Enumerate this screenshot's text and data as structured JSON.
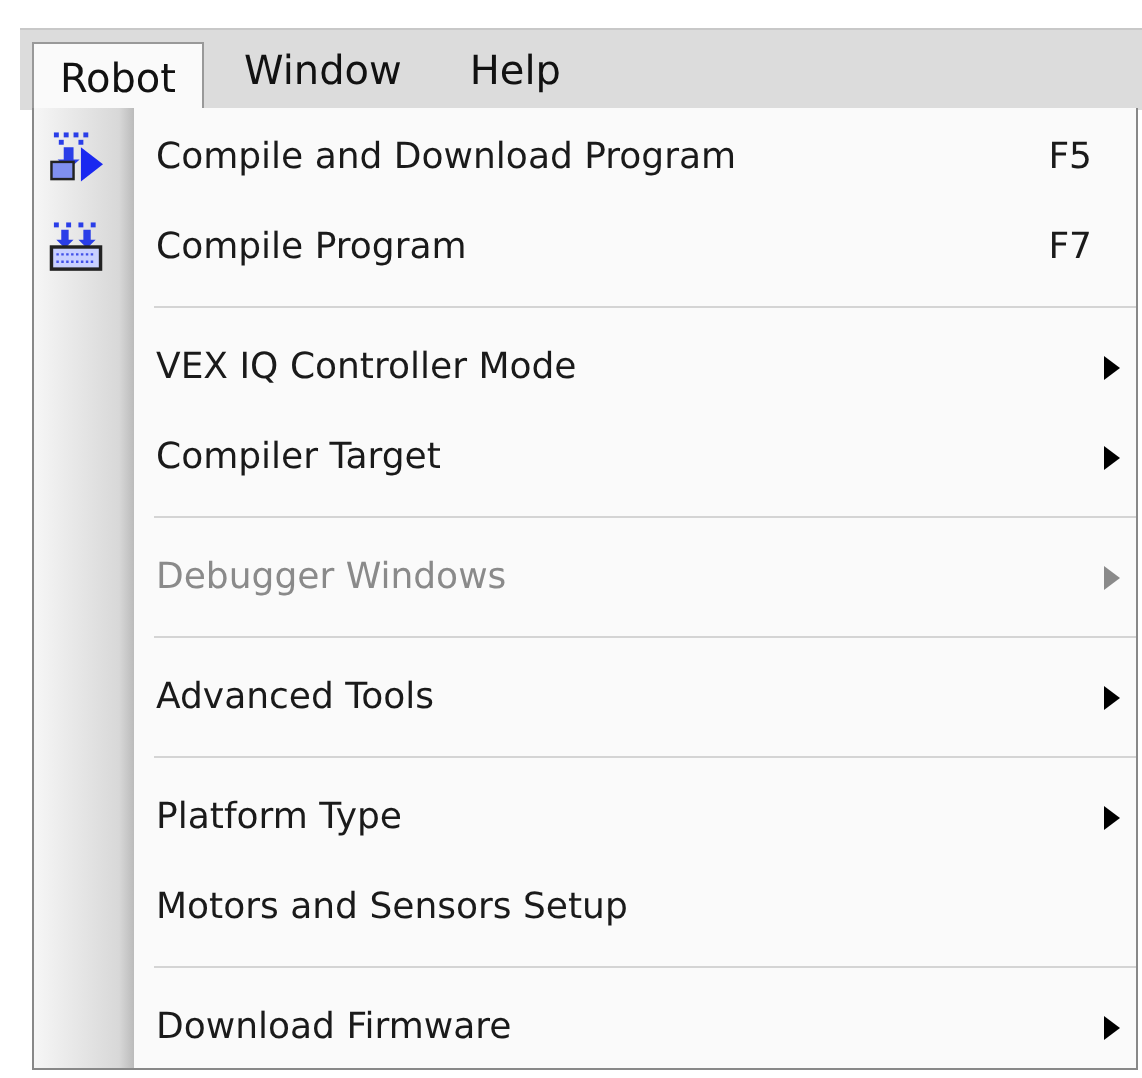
{
  "menubar": [
    {
      "label": "Robot",
      "selected": true
    },
    {
      "label": "Window",
      "selected": false
    },
    {
      "label": "Help",
      "selected": false
    }
  ],
  "menu": [
    {
      "kind": "command",
      "label": "Compile and Download Program",
      "shortcut": "F5",
      "disabled": false,
      "submenu": false
    },
    {
      "kind": "command",
      "label": "Compile Program",
      "shortcut": "F7",
      "disabled": false,
      "submenu": false
    },
    {
      "kind": "separator"
    },
    {
      "kind": "item",
      "label": "VEX IQ Controller Mode",
      "disabled": false,
      "submenu": true
    },
    {
      "kind": "item",
      "label": "Compiler Target",
      "disabled": false,
      "submenu": true
    },
    {
      "kind": "separator"
    },
    {
      "kind": "item",
      "label": "Debugger Windows",
      "disabled": true,
      "submenu": true
    },
    {
      "kind": "separator"
    },
    {
      "kind": "item",
      "label": "Advanced Tools",
      "disabled": false,
      "submenu": true
    },
    {
      "kind": "separator"
    },
    {
      "kind": "item",
      "label": "Platform Type",
      "disabled": false,
      "submenu": true
    },
    {
      "kind": "item",
      "label": "Motors and Sensors Setup",
      "disabled": false,
      "submenu": false
    },
    {
      "kind": "separator"
    },
    {
      "kind": "item",
      "label": "Download Firmware",
      "disabled": false,
      "submenu": true
    }
  ]
}
